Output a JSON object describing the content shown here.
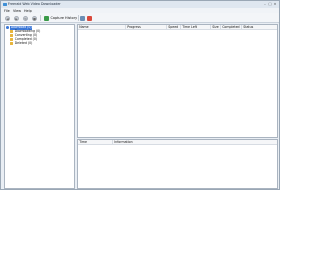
{
  "window": {
    "title": "Freeraid Web Video Downloader",
    "controls": {
      "minimize": "–",
      "maximize": "□",
      "close": "×"
    }
  },
  "menu": {
    "items": [
      "File",
      "View",
      "Help"
    ]
  },
  "toolbar": {
    "back_icon": "back-arrow-icon",
    "forward_icon": "forward-arrow-icon",
    "refresh_icon": "refresh-icon",
    "stop_icon": "stop-icon",
    "capture_label": "Capture History",
    "settings_icon": "settings-icon",
    "delete_icon": "delete-icon"
  },
  "tree": {
    "root": "Download (0)",
    "children": [
      "Downloading (0)",
      "Converting (0)",
      "Completed (0)",
      "Deleted (0)"
    ]
  },
  "download_list": {
    "columns": [
      "Name",
      "Progress",
      "Speed",
      "Time Left",
      "Size",
      "Completed",
      "Status"
    ]
  },
  "log_panel": {
    "columns": [
      "Time",
      "Information"
    ]
  },
  "colors": {
    "selection": "#3c78d8",
    "folder": "#e7b53c",
    "capture_icon": "#3a9a48",
    "delete_icon": "#d9483b"
  }
}
